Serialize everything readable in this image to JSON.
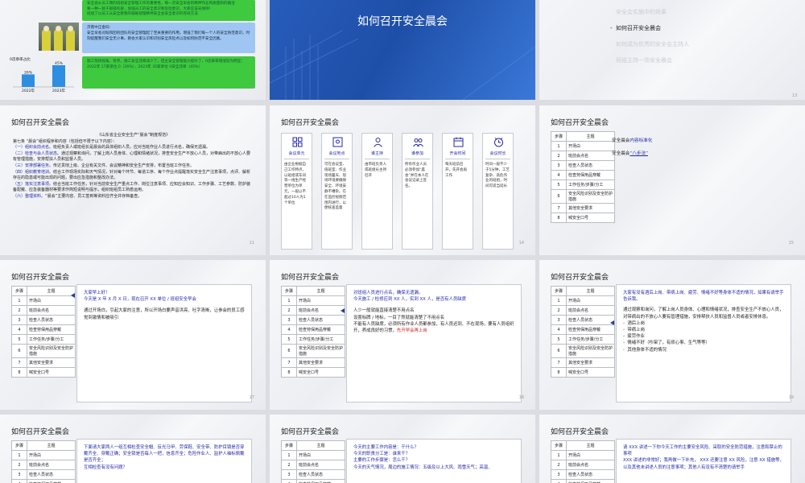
{
  "slide1": {
    "box_top_lines": [
      "安全会从员工我的班组安全管理工作的重要性，每一次安全早会的精神作业和质量和的融洽",
      "要一种一就干部部的部，加强员工的安全意识和危险意识，大家应该去保持！",
      "班组了以员工从安全教我的辅助管理精神安全会安全意识的有效方法"
    ],
    "label": "济南中正金码：",
    "box_mid": "安全早会对既和团的团队的安全管理起了至关重要的作用。增强了我们每一个人的安全防范意识，时刻提醒我们安全无小事。教会大家认识和识别安全风险点以及如何防范不安全因素。",
    "box_bot": "施工现场视角，有序，施工安全违章减少了，但主安全管理能力提升了，0违章率增涨较为明显：2022年 17家单位 0（26%），2023年 35家单位 0安全违章（45%）",
    "chart_title": "0违章率占比",
    "chart_data": {
      "type": "bar",
      "categories": [
        "2022年",
        "2023年"
      ],
      "values": [
        26,
        45
      ],
      "unit": "%"
    }
  },
  "slide2": {
    "title": "如何召开安全晨会"
  },
  "slide3": {
    "items": [
      "安全会实施中的效果",
      "如何召开安全晨会",
      "如何成为优秀的安全会主持人",
      "班组主持一场安全晨会"
    ],
    "current_index": 1
  },
  "common": {
    "title": "如何召开安全晨会",
    "steps_header": [
      "步骤",
      "主题"
    ],
    "steps": [
      "开场白",
      "班前会点名",
      "检查人员状态",
      "检查劳保用品穿戴",
      "工作任务/步骤/分工",
      "安全风险识别及安全防护措施",
      "其他安全要求",
      "喊安全口号"
    ]
  },
  "slide4": {
    "page": "11",
    "doc_title": "《山东省企业安全生产“晨会”制度规范》",
    "chapter": "第七条 “晨会”组织程序和内容（包括但不限于以下内容）：",
    "items": [
      {
        "head": "（一）组织会前点名。",
        "text": "班组负责人或班组长是晨会的具体组织人员，应对当班作业人员进行点名，确保无遗漏。"
      },
      {
        "head": "（二）检查与会人员状态。",
        "text": "通过观察和询问，了解上岗人员身体、心理和情绪状况，排查安全生产不放心人员，对带病出的不放心人要有管理措施，安排帮扶人员和监督人员。"
      },
      {
        "head": "（三）安排部署任务。",
        "text": "传达贯彻上级、企业有关文件、会议精神和安全生产安排，布置当班工作任务。"
      },
      {
        "head": "（四）组织教育培训。",
        "text": "结合工作现场实际和天气情况，针对每个环节、每道工序、每个作业点提醒落实安全生产注意事项，点评、解析存在的隐患或可能出现的问题，要出应急措施和整改办法。"
      },
      {
        "head": "（五）落实注意事项。",
        "text": "结合当班工作任务，针对当前安全生产重点工作、岗位注意事项、应知应会知识、工作步骤、工艺参数、防护装备配戴、应急装备器材等要求作简短说明与提示，组织班组员工熟悉运用。"
      },
      {
        "head": "（六）整理资料。",
        "text": "“晨会”主要内容、员工签到等资料应齐全并存档备查。"
      }
    ]
  },
  "slide5": {
    "page": "14",
    "cards": [
      {
        "icon": "grid-icon",
        "label": "会议单元",
        "text": "由企业根据自己工作特点，以班组或车间等一线生产经营单位为单元。一般以不超过10人为1个单位"
      },
      {
        "icon": "location-icon",
        "label": "会议地点",
        "text": "可在会议室、值班室、作业现场露天、现场环境要确保安全、环境安静不嘈杂。在在监控视频范围内进行，以便核查监督"
      },
      {
        "icon": "person-icon",
        "label": "谁主持",
        "text": "由带班负责人或班组长主持召开"
      },
      {
        "icon": "group-icon",
        "label": "谁参加",
        "text": "所有作业人员必须参加“晨会”并在本人在会议记录上签名。"
      },
      {
        "icon": "calendar-icon",
        "label": "开会时间",
        "text": "每天班前召开，先开会再工作"
      },
      {
        "icon": "clock-icon",
        "label": "会议时长",
        "text": "时间一般不少于5分钟，工艺复杂、高危作业的班组，时间可适当延长"
      }
    ]
  },
  "slide6": {
    "page": "15",
    "line1_prefix": "安全晨会",
    "line1_hl": "内容标准化",
    "line2_prefix": "安全晨会",
    "line2_hl": "“八步法”"
  },
  "slide7": {
    "page": "17",
    "lines": [
      "大家早上好！",
      "今天是 X 年 X 月 X 日，现在召开 XX 单位 / 班组安全早会"
    ],
    "body": "通过开场白，引起大家的注意，所以开场白要声音洪亮、吐字清晰，让参会的员工感觉到激情和被吸引"
  },
  "slide8": {
    "page": "18",
    "lines": [
      "对班组人员进行点名，确保无遗漏。",
      "今天施工 / 检修应到 XX 人，实到 XX 人，是否有人员缺席"
    ],
    "body1": "人少一般就能直接清楚不用点名",
    "body2": "设置标牌 / 地标，一目了然就能清楚了不用点名",
    "body3": "不能有人员缺席，必须所有作业人员都参加，有人员迟到、不在现场，要有人员组织开，养成良好的习惯，",
    "body3_red": "先开早会再上岗"
  },
  "slide9": {
    "page": "19",
    "lead": "大家有没有酒后上岗、带病上岗、疲劳、情绪不好等身体不适的情况，如果有请举手告诉我。",
    "body": "通过观察和询问，了解上岗人员身体、心理和情绪状况，排查安全生产不放心人员，对带病出的不放心人要有管理措施，安排帮扶人员和监督人员或者安排休息。",
    "bullets": [
      "酒后上岗",
      "带病上岗",
      "疲劳作业",
      "情绪不好（吵架了，有烦心事、生气等等）",
      "其他身体不适的情况"
    ]
  },
  "slide10": {
    "lines": [
      "下面请大家两人一组互相检查安全帽、反光马甲、劳保鞋、安全带、防护目镜是否穿戴齐全、穿戴正确；安全锁是否每人一把，信息齐全；危险作业人、监护人袖标佩戴是否齐全；",
      "互相检查有没有问题？"
    ]
  },
  "slide11": {
    "lines": [
      "今天的主要工作内容是：干什么？",
      "今天的职责分工是：谁来干？",
      "主要的工作步骤是：怎么干？",
      "今天的天气情况，周边的施工情况：五级及以上大风、雨雪天气；高温、"
    ]
  },
  "slide12": {
    "lines": [
      "请 XXX 讲述一下你今天工作的主要安全风险、采取的安全防范措施，注意和禁止的事项",
      "XXX 讲述的非常好；我再做一下补充， XXX 还要注意 XX 风险，注意 XX 措施等，以及其他未讲述人员的注意事项；其他人有没有不清楚的请举手"
    ]
  }
}
